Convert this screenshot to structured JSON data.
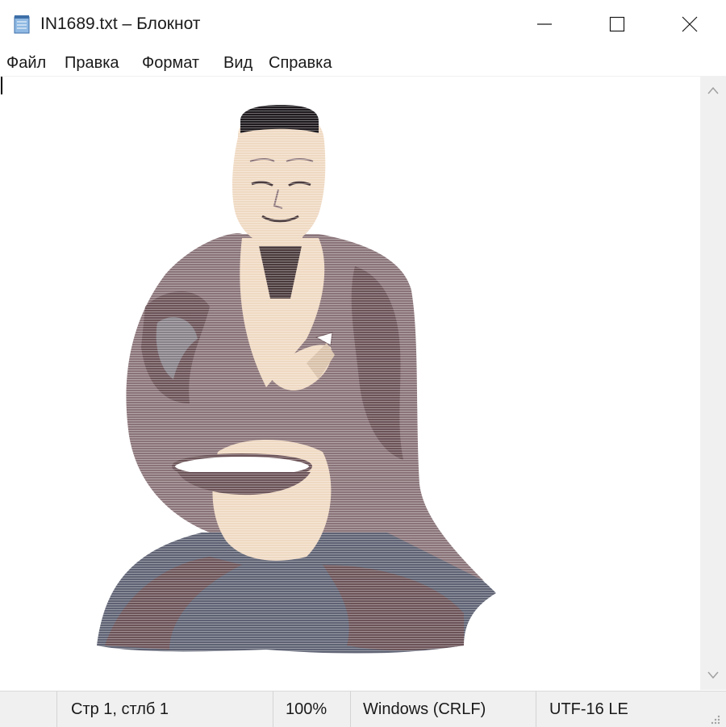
{
  "window": {
    "title": "IN1689.txt – Блокнот",
    "icon": "notepad-icon",
    "controls": [
      "minimize-icon",
      "maximize-icon",
      "close-icon"
    ]
  },
  "menu": {
    "items": [
      "Файл",
      "Правка",
      "Формат",
      "Вид",
      "Справка"
    ]
  },
  "editor": {
    "content_description_icon": "ascii-art-seated-man",
    "colors": {
      "robe": "#8a7479",
      "robe_dark": "#6b5358",
      "skin": "#efd9c2",
      "trousers": "#5e6273",
      "hat": "#1e1a1e"
    }
  },
  "status": {
    "position": "Стр 1, стлб 1",
    "zoom": "100%",
    "line_endings": "Windows (CRLF)",
    "encoding": "UTF-16 LE"
  }
}
